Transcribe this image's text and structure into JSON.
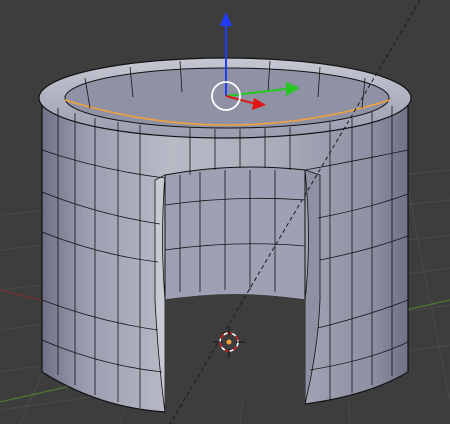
{
  "viewport": {
    "background": "#3d3d3d",
    "grid_color": "#4a4a4a",
    "axis_x_color": "#6e2a2a",
    "axis_y_color": "#4f7a2f"
  },
  "mesh": {
    "object": "hollow-cylinder-with-cutout",
    "fill_light": "#b5b7c3",
    "fill_mid": "#9b9db0",
    "fill_dark": "#6f7186",
    "wire_color": "#111111",
    "selected_edge_color": "#f2a23a"
  },
  "gizmo": {
    "z_axis_color": "#1f3cff",
    "y_axis_color": "#24c820",
    "x_axis_color": "#e01515",
    "center_ring_color": "#ffffff",
    "icon": "transform-gizmo-icon"
  },
  "cursor_3d": {
    "icon": "3d-cursor-icon",
    "colors": [
      "#ffffff",
      "#d02020"
    ]
  },
  "view_line": {
    "color": "#1a1a1a",
    "style": "dashed"
  }
}
